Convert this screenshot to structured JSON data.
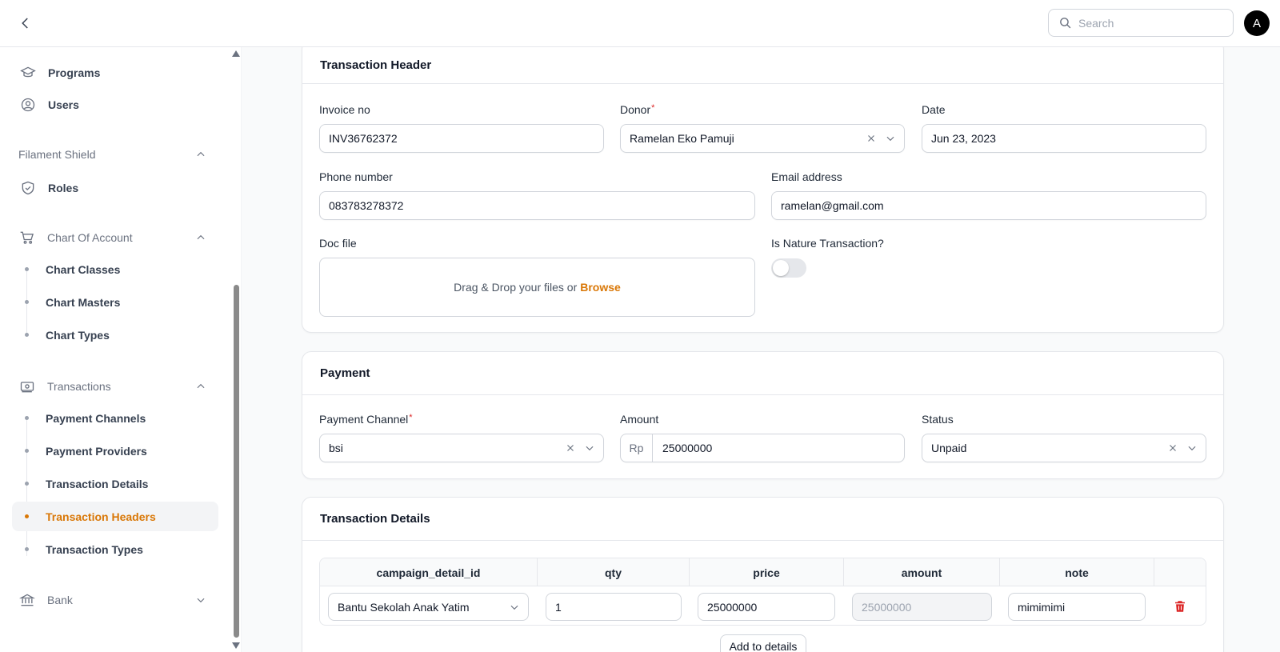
{
  "topbar": {
    "search_placeholder": "Search",
    "avatar_initial": "A"
  },
  "sidebar": {
    "items": [
      {
        "label": "Programs",
        "icon": "graduation-cap-icon"
      },
      {
        "label": "Users",
        "icon": "user-circle-icon"
      }
    ],
    "groups": [
      {
        "label": "Filament Shield",
        "expanded": true,
        "items": [
          {
            "label": "Roles",
            "icon": "shield-check-icon"
          }
        ]
      },
      {
        "label": "Chart Of Account",
        "icon": "cart-icon",
        "expanded": true,
        "items": [
          {
            "label": "Chart Classes"
          },
          {
            "label": "Chart Masters"
          },
          {
            "label": "Chart Types"
          }
        ]
      },
      {
        "label": "Transactions",
        "icon": "banknotes-icon",
        "expanded": true,
        "items": [
          {
            "label": "Payment Channels"
          },
          {
            "label": "Payment Providers"
          },
          {
            "label": "Transaction Details"
          },
          {
            "label": "Transaction Headers",
            "active": true
          },
          {
            "label": "Transaction Types"
          }
        ]
      },
      {
        "label": "Bank",
        "icon": "bank-icon",
        "expanded": false
      }
    ],
    "active_color": "#d97706"
  },
  "header_section": {
    "title": "Transaction Header",
    "invoice_label": "Invoice no",
    "invoice_value": "INV36762372",
    "donor_label": "Donor",
    "donor_required": "*",
    "donor_value": "Ramelan Eko Pamuji",
    "date_label": "Date",
    "date_value": "Jun 23, 2023",
    "phone_label": "Phone number",
    "phone_value": "083783278372",
    "email_label": "Email address",
    "email_value": "ramelan@gmail.com",
    "doc_label": "Doc file",
    "doc_drop_text": "Drag & Drop your files or",
    "doc_browse": "Browse",
    "nature_label": "Is Nature Transaction?",
    "nature_on": false
  },
  "payment_section": {
    "title": "Payment",
    "channel_label": "Payment Channel",
    "channel_required": "*",
    "channel_value": "bsi",
    "amount_label": "Amount",
    "amount_prefix": "Rp",
    "amount_value": "25000000",
    "status_label": "Status",
    "status_value": "Unpaid"
  },
  "details_section": {
    "title": "Transaction Details",
    "columns": [
      "campaign_detail_id",
      "qty",
      "price",
      "amount",
      "note"
    ],
    "rows": [
      {
        "campaign_detail_id": "Bantu Sekolah Anak Yatim",
        "qty": "1",
        "price": "25000000",
        "amount": "25000000",
        "note": "mimimimi"
      }
    ],
    "add_button": "Add to details",
    "delete_color": "#dc2626"
  }
}
